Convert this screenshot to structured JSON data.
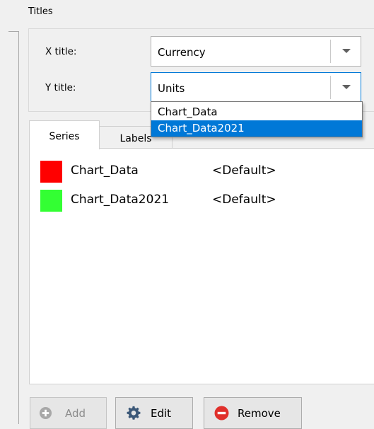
{
  "titles_group": {
    "label": "Titles",
    "x_title_label": "X title:",
    "x_title_value": "Currency",
    "y_title_label": "Y title:",
    "y_title_value": "Units"
  },
  "dropdown": {
    "options": [
      "Chart_Data",
      "Chart_Data2021"
    ],
    "highlighted": "Chart_Data2021"
  },
  "tabs": [
    {
      "label": "Series",
      "active": true
    },
    {
      "label": "Labels",
      "active": false
    }
  ],
  "series": [
    {
      "name": "Chart_Data",
      "style": "<Default>",
      "color": "#ff0000"
    },
    {
      "name": "Chart_Data2021",
      "style": "<Default>",
      "color": "#33ff33"
    }
  ],
  "buttons": {
    "add": {
      "label": "Add",
      "enabled": false
    },
    "edit": {
      "label": "Edit",
      "enabled": true
    },
    "remove": {
      "label": "Remove",
      "enabled": true
    }
  },
  "colors": {
    "accent": "#0078d7",
    "remove_icon": "#e0302b"
  }
}
